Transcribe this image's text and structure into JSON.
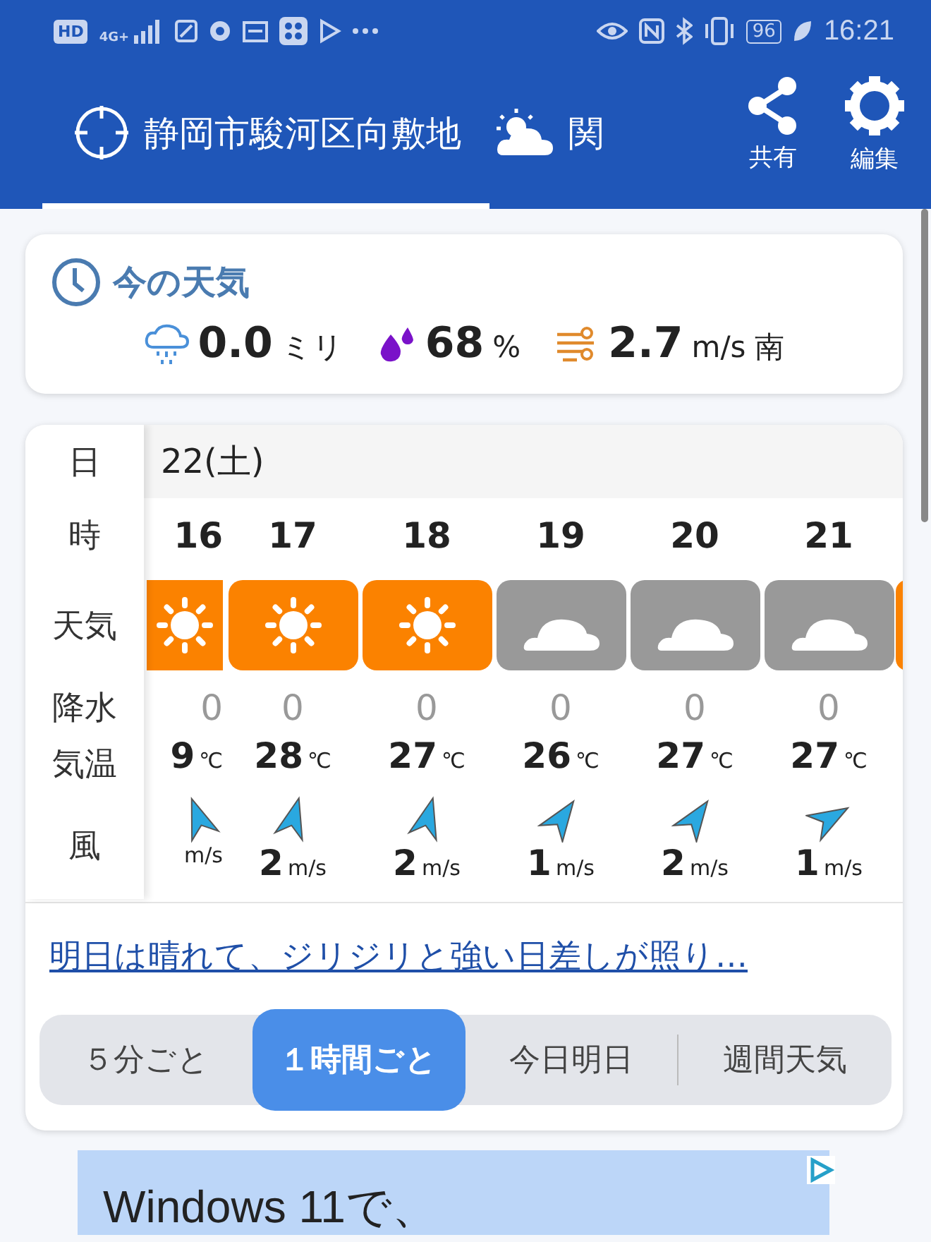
{
  "status_bar": {
    "hd": "HD",
    "network": "4G+",
    "battery": "96",
    "time": "16:21"
  },
  "header": {
    "tabs": [
      {
        "label": "静岡市駿河区向敷地",
        "kind": "location",
        "selected": true
      },
      {
        "label": "関",
        "kind": "region",
        "selected": false
      }
    ],
    "actions": [
      {
        "label": "共有",
        "kind": "share"
      },
      {
        "label": "編集",
        "kind": "settings"
      }
    ]
  },
  "current": {
    "title": "今の天気",
    "rain": "0.0",
    "rain_unit": "ミリ",
    "humidity": "68",
    "humidity_unit": "%",
    "wind": "2.7",
    "wind_unit": "m/s",
    "wind_dir": "南"
  },
  "hourly": {
    "labels": [
      "日",
      "時",
      "天気",
      "降水",
      "気温",
      "風"
    ],
    "day": "22(土)",
    "hours": [
      {
        "hour": "16",
        "kind": "sunny",
        "precip": "0",
        "temp": "9",
        "temp_unit": "℃",
        "wind": {
          "kind": "nnw",
          "unit": "m/s"
        },
        "cut": true
      },
      {
        "hour": "17",
        "kind": "sunny",
        "precip": "0",
        "temp": "28",
        "temp_unit": "℃",
        "wind": {
          "kind": "nne",
          "speed": "2",
          "unit": "m/s"
        },
        "cut": false
      },
      {
        "hour": "18",
        "kind": "sunny",
        "precip": "0",
        "temp": "27",
        "temp_unit": "℃",
        "wind": {
          "kind": "nne",
          "speed": "2",
          "unit": "m/s"
        },
        "cut": false
      },
      {
        "hour": "19",
        "kind": "cloudy",
        "precip": "0",
        "temp": "26",
        "temp_unit": "℃",
        "wind": {
          "kind": "ne",
          "speed": "1",
          "unit": "m/s"
        },
        "cut": false
      },
      {
        "hour": "20",
        "kind": "cloudy",
        "precip": "0",
        "temp": "27",
        "temp_unit": "℃",
        "wind": {
          "kind": "ne",
          "speed": "2",
          "unit": "m/s"
        },
        "cut": false
      },
      {
        "hour": "21",
        "kind": "cloudy",
        "precip": "0",
        "temp": "27",
        "temp_unit": "℃",
        "wind": {
          "kind": "ene",
          "speed": "1",
          "unit": "m/s"
        },
        "cut": false
      }
    ],
    "forecast_link": "明日は晴れて、ジリジリと強い日差しが照り…",
    "modes": [
      {
        "label": "５分ごと",
        "selected": false
      },
      {
        "label": "１時間ごと",
        "selected": true
      },
      {
        "label": "今日明日",
        "selected": false
      },
      {
        "label": "週間天気",
        "selected": false
      }
    ]
  },
  "ad": {
    "text": "Windows 11で、"
  }
}
